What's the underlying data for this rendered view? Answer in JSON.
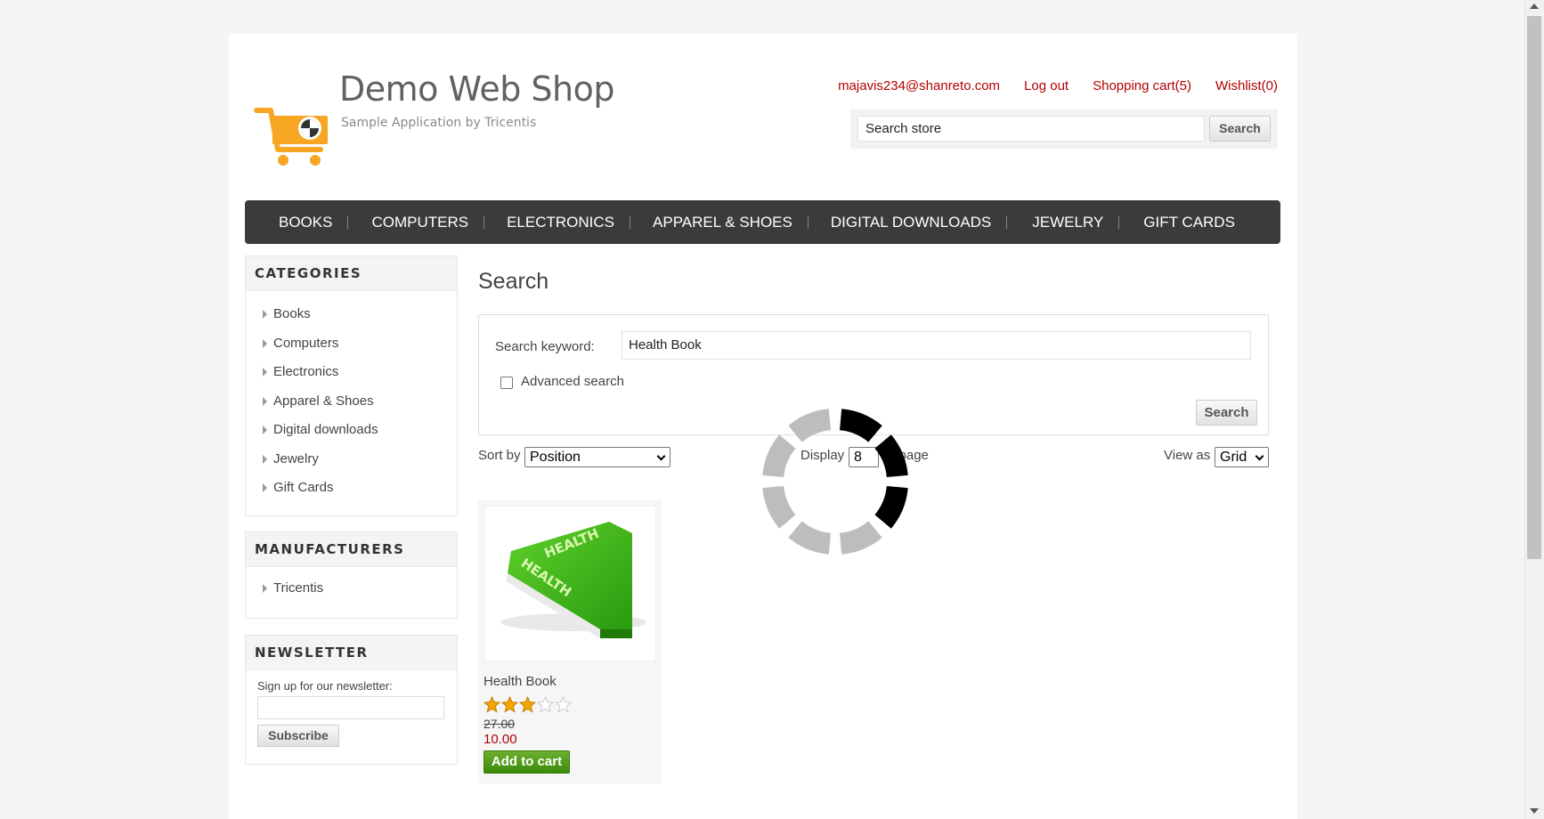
{
  "header": {
    "shop_title": "Demo Web Shop",
    "shop_subtitle": "Sample Application by Tricentis",
    "links": {
      "account": "majavis234@shanreto.com",
      "logout": "Log out",
      "cart": "Shopping cart(5)",
      "wishlist": "Wishlist(0)"
    },
    "search": {
      "placeholder": "Search store",
      "value": "Search store",
      "button": "Search"
    }
  },
  "top_menu": [
    "BOOKS",
    "COMPUTERS",
    "ELECTRONICS",
    "APPAREL & SHOES",
    "DIGITAL DOWNLOADS",
    "JEWELRY",
    "GIFT CARDS"
  ],
  "sidebar": {
    "categories": {
      "title": "CATEGORIES",
      "items": [
        "Books",
        "Computers",
        "Electronics",
        "Apparel & Shoes",
        "Digital downloads",
        "Jewelry",
        "Gift Cards"
      ]
    },
    "manufacturers": {
      "title": "MANUFACTURERS",
      "items": [
        "Tricentis"
      ]
    },
    "newsletter": {
      "title": "NEWSLETTER",
      "label": "Sign up for our newsletter:",
      "input_value": "",
      "button": "Subscribe"
    }
  },
  "main": {
    "title": "Search",
    "search_form": {
      "keyword_label": "Search keyword:",
      "keyword_value": "Health Book",
      "advanced_label": "Advanced search",
      "advanced_checked": false,
      "button": "Search"
    },
    "sort": {
      "label": "Sort by",
      "value": "Position"
    },
    "display": {
      "label": "Display",
      "value": "8",
      "suffix": "er page"
    },
    "view_as": {
      "label": "View as",
      "value": "Grid"
    },
    "products": [
      {
        "title": "Health Book",
        "image_label_1": "HEALTH",
        "image_label_2": "HEALTH",
        "rating_stars": 3,
        "rating_max": 5,
        "old_price": "27.00",
        "price": "10.00",
        "button": "Add to cart"
      }
    ]
  },
  "colors": {
    "link_red": "#b30000",
    "menu_bg": "#3b3b3b",
    "logo_orange": "#f6a623",
    "cart_green": "#4e9a1b"
  }
}
